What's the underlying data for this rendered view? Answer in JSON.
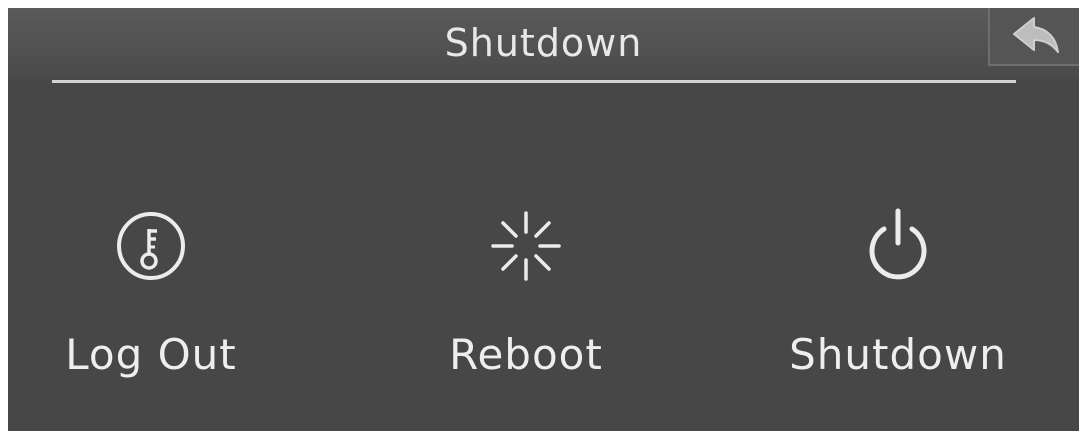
{
  "header": {
    "title": "Shutdown",
    "back_icon": "back-arrow-icon"
  },
  "actions": [
    {
      "label": "Log Out",
      "icon": "key-icon"
    },
    {
      "label": "Reboot",
      "icon": "reboot-spinner-icon"
    },
    {
      "label": "Shutdown",
      "icon": "power-icon"
    }
  ],
  "colors": {
    "panel_background": "#474747",
    "header_background": "#555555",
    "text": "#eeeeee",
    "divider": "#d4d4d4"
  }
}
